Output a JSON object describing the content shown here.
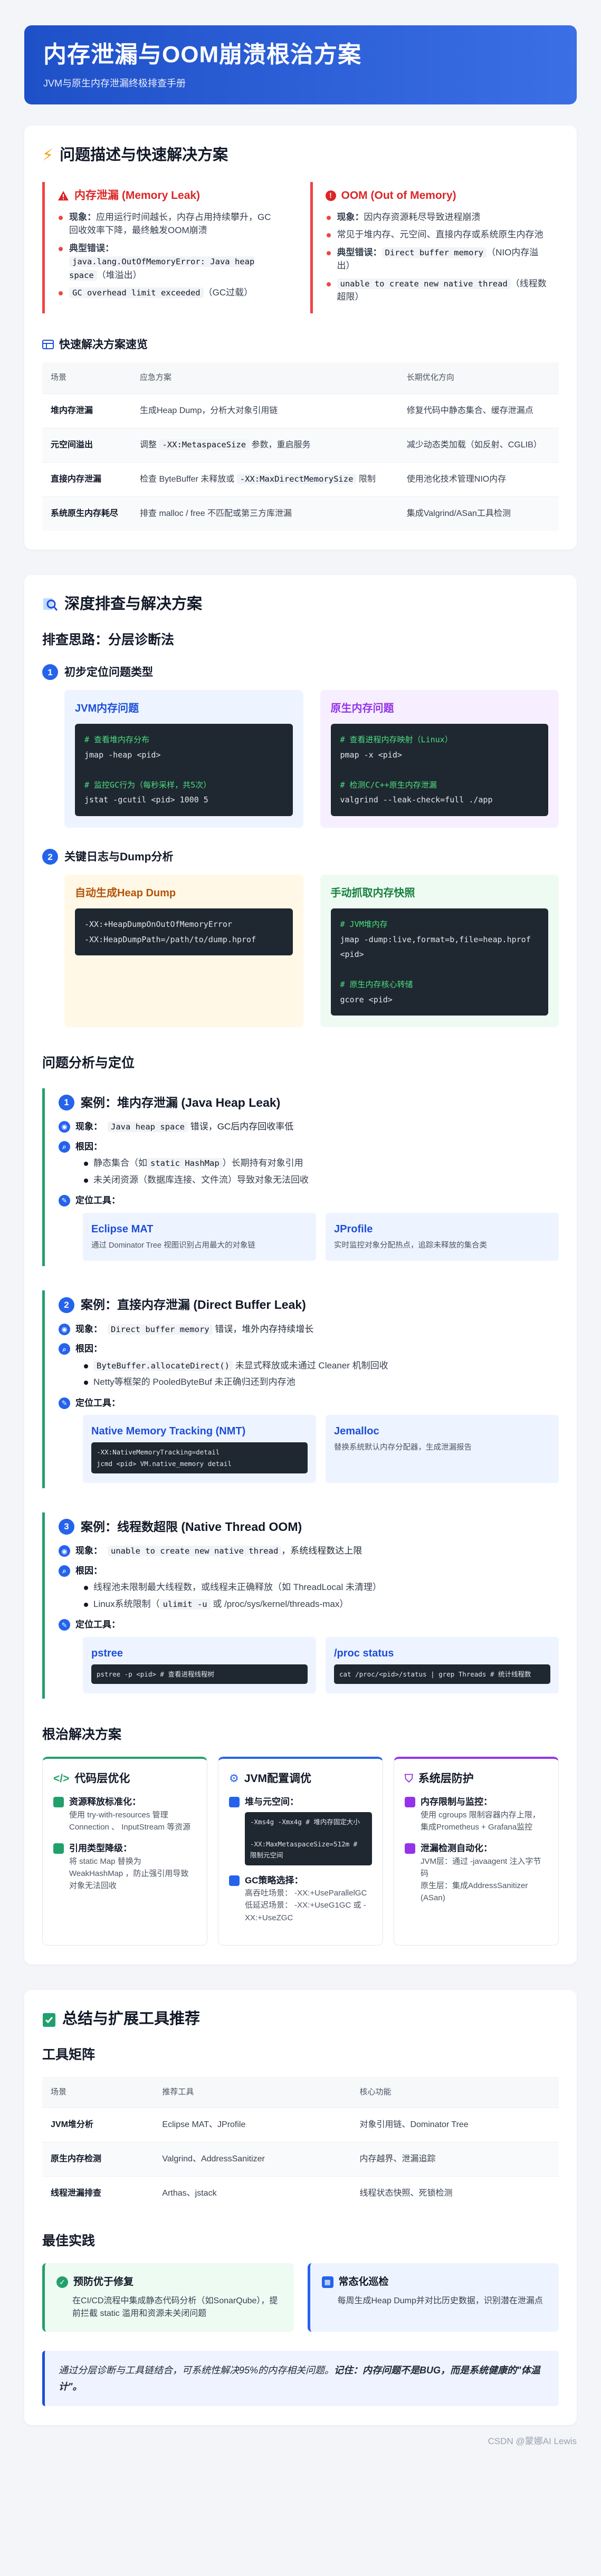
{
  "header": {
    "title": "内存泄漏与OOM崩溃根治方案",
    "subtitle": "JVM与原生内存泄漏终极排查手册"
  },
  "problem": {
    "title": "问题描述与快速解决方案",
    "leak": {
      "title": "内存泄漏 (Memory Leak)",
      "items": [
        {
          "label": "现象：",
          "text": "应用运行时间越长，内存占用持续攀升，GC回收效率下降，最终触发OOM崩溃"
        },
        {
          "label": "典型错误：",
          "code": "java.lang.OutOfMemoryError: Java heap space",
          "text": "（堆溢出）"
        },
        {
          "code": "GC overhead limit exceeded",
          "text": "（GC过载）"
        }
      ]
    },
    "oom": {
      "title": "OOM (Out of Memory)",
      "items": [
        {
          "label": "现象：",
          "text": "因内存资源耗尽导致进程崩溃"
        },
        {
          "text": "常见于堆内存、元空间、直接内存或系统原生内存池"
        },
        {
          "label": "典型错误：",
          "code": "Direct buffer memory",
          "text": "（NIO内存溢出）"
        },
        {
          "code": "unable to create new native thread",
          "text": "（线程数超限）"
        }
      ]
    },
    "table_title": "快速解决方案速览",
    "table": {
      "headers": [
        "场景",
        "应急方案",
        "长期优化方向"
      ],
      "rows": [
        {
          "c1": "堆内存泄漏",
          "c2": "生成Heap Dump，分析大对象引用链",
          "c3": "修复代码中静态集合、缓存泄漏点"
        },
        {
          "c1": "元空间溢出",
          "c2a": "调整 ",
          "c2code": "-XX:MetaspaceSize",
          "c2b": " 参数，重启服务",
          "c3": "减少动态类加载（如反射、CGLIB）"
        },
        {
          "c1": "直接内存泄漏",
          "c2a": "检查 ByteBuffer 未释放或 ",
          "c2code": "-XX:MaxDirectMemorySize",
          "c2b": " 限制",
          "c3": "使用池化技术管理NIO内存"
        },
        {
          "c1": "系统原生内存耗尽",
          "c2": "排查 malloc / free 不匹配或第三方库泄漏",
          "c3": "集成Valgrind/ASan工具检测"
        }
      ]
    }
  },
  "deep": {
    "title": "深度排查与解决方案",
    "subtitle": "排查思路：分层诊断法",
    "step1": "初步定位问题类型",
    "jvm_panel": {
      "title": "JVM内存问题",
      "lines": [
        "# 查看堆内存分布",
        "jmap -heap <pid>",
        "",
        "# 监控GC行为（每秒采样，共5次）",
        "jstat -gcutil <pid> 1000 5"
      ]
    },
    "native_panel": {
      "title": "原生内存问题",
      "lines": [
        "# 查看进程内存映射（Linux）",
        "pmap -x <pid>",
        "",
        "# 检测C/C++原生内存泄漏",
        "valgrind --leak-check=full ./app"
      ]
    },
    "step2": "关键日志与Dump分析",
    "auto_panel": {
      "title": "自动生成Heap Dump",
      "lines": [
        "-XX:+HeapDumpOnOutOfMemoryError",
        "-XX:HeapDumpPath=/path/to/dump.hprof"
      ]
    },
    "manual_panel": {
      "title": "手动抓取内存快照",
      "lines": [
        "# JVM堆内存",
        "jmap -dump:live,format=b,file=heap.hprof <pid>",
        "",
        "# 原生内存核心转储",
        "gcore <pid>"
      ]
    },
    "analysis_title": "问题分析与定位",
    "cases": [
      {
        "num": "1",
        "title": "案例：堆内存泄漏 (Java Heap Leak)",
        "symptom_a": "",
        "symptom_code": "Java heap space",
        "symptom_b": " 错误，GC后内存回收率低",
        "causes": [
          {
            "a": "静态集合（如",
            "code": "static HashMap",
            "b": "）长期持有对象引用"
          },
          {
            "a": "未关闭资源（数据库连接、文件流）导致对象无法回收",
            "code": "",
            "b": ""
          }
        ],
        "tools": [
          {
            "name": "Eclipse MAT",
            "desc": "通过 Dominator Tree 视图识别占用最大的对象链"
          },
          {
            "name": "JProfile",
            "desc": "实时监控对象分配热点，追踪未释放的集合类"
          }
        ]
      },
      {
        "num": "2",
        "title": "案例：直接内存泄漏 (Direct Buffer Leak)",
        "symptom_a": "",
        "symptom_code": "Direct buffer memory",
        "symptom_b": " 错误，堆外内存持续增长",
        "causes": [
          {
            "a": "",
            "code": "ByteBuffer.allocateDirect()",
            "b": " 未显式释放或未通过 Cleaner 机制回收"
          },
          {
            "a": "Netty等框架的 PooledByteBuf 未正确归还到内存池",
            "code": "",
            "b": ""
          }
        ],
        "tools": [
          {
            "name": "Native Memory Tracking (NMT)",
            "code": [
              "-XX:NativeMemoryTracking=detail",
              "jcmd <pid> VM.native_memory detail"
            ]
          },
          {
            "name": "Jemalloc",
            "desc": "替换系统默认内存分配器，生成泄漏报告"
          }
        ]
      },
      {
        "num": "3",
        "title": "案例：线程数超限 (Native Thread OOM)",
        "symptom_a": "",
        "symptom_code": "unable to create new native thread",
        "symptom_b": "，系统线程数达上限",
        "causes": [
          {
            "a": "线程池未限制最大线程数，或线程未正确释放（如 ThreadLocal 未清理）",
            "code": "",
            "b": ""
          },
          {
            "a": "Linux系统限制（",
            "code": "ulimit -u",
            "b": " 或 /proc/sys/kernel/threads-max）"
          }
        ],
        "tools": [
          {
            "name": "pstree",
            "code": [
              "pstree -p <pid> # 查看进程线程树"
            ]
          },
          {
            "name": "/proc status",
            "code": [
              "cat /proc/<pid>/status | grep Threads # 统计线程数"
            ]
          }
        ]
      }
    ],
    "labels": {
      "symptom": "现象：",
      "cause": "根因：",
      "tools": "定位工具："
    },
    "strategy_title": "根治解决方案",
    "strategies": [
      {
        "title": "代码层优化",
        "items": [
          {
            "label": "资源释放标准化：",
            "desc": "使用 try-with-resources 管理 Connection 、 InputStream 等资源"
          },
          {
            "label": "引用类型降级：",
            "desc": "将 static Map 替换为 WeakHashMap ，防止强引用导致对象无法回收"
          }
        ]
      },
      {
        "title": "JVM配置调优",
        "items": [
          {
            "label": "堆与元空间：",
            "code": "-Xms4g -Xmx4g # 堆内存固定大小\n\n-XX:MaxMetaspaceSize=512m # 限制元空间"
          },
          {
            "label": "GC策略选择：",
            "desc": "高吞吐场景： -XX:+UseParallelGC\n低延迟场景： -XX:+UseG1GC 或 -XX:+UseZGC"
          }
        ]
      },
      {
        "title": "系统层防护",
        "items": [
          {
            "label": "内存限制与监控：",
            "desc": "使用 cgroups 限制容器内存上限，集成Prometheus + Grafana监控"
          },
          {
            "label": "泄漏检测自动化：",
            "desc": "JVM层：通过 -javaagent 注入字节码\n原生层：集成AddressSanitizer (ASan)"
          }
        ]
      }
    ]
  },
  "summary": {
    "title": "总结与扩展工具推荐",
    "matrix_title": "工具矩阵",
    "headers": [
      "场景",
      "推荐工具",
      "核心功能"
    ],
    "rows": [
      {
        "c1": "JVM堆分析",
        "c2": "Eclipse MAT、JProfile",
        "c3": "对象引用链、Dominator Tree"
      },
      {
        "c1": "原生内存检测",
        "c2": "Valgrind、AddressSanitizer",
        "c3": "内存越界、泄漏追踪"
      },
      {
        "c1": "线程泄漏排查",
        "c2": "Arthas、jstack",
        "c3": "线程状态快照、死锁检测"
      }
    ],
    "best_title": "最佳实践",
    "best": [
      {
        "title": "预防优于修复",
        "desc": "在CI/CD流程中集成静态代码分析（如SonarQube），提前拦截 static 滥用和资源未关闭问题"
      },
      {
        "title": "常态化巡检",
        "desc": "每周生成Heap Dump并对比历史数据，识别潜在泄漏点"
      }
    ],
    "quote_a": "通过分层诊断与工具链结合，可系统性解决95%的内存相关问题。",
    "quote_b": "记住：内存问题不是BUG，而是系统健康的\"体温计\"。"
  },
  "watermark": "CSDN @蒙娜AI Lewis",
  "colors": {
    "accent": "#1e50c8",
    "danger": "#dc2626",
    "success": "#22a06b",
    "jvm": "#2563eb",
    "native": "#9333ea"
  }
}
